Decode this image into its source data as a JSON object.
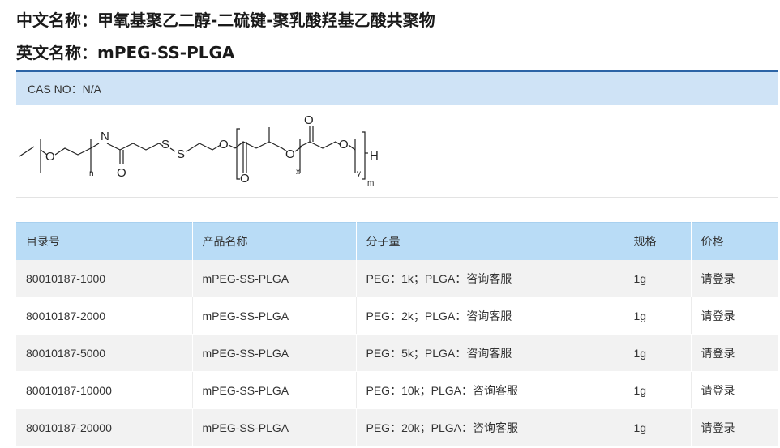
{
  "product": {
    "cn_label": "中文名称：",
    "cn_name": "甲氧基聚乙二醇-二硫键-聚乳酸羟基乙酸共聚物",
    "en_label": "英文名称：",
    "en_name": "mPEG-SS-PLGA",
    "cas": "CAS NO：N/A"
  },
  "structure": {
    "atoms": {
      "o": "O",
      "n": "N",
      "h": "H",
      "s": "S"
    },
    "subscripts": {
      "n": "n",
      "x": "x",
      "y": "y",
      "m": "m"
    }
  },
  "table": {
    "headers": [
      "目录号",
      "产品名称",
      "分子量",
      "规格",
      "价格"
    ],
    "rows": [
      [
        "80010187-1000",
        "mPEG-SS-PLGA",
        "PEG：1k；PLGA：咨询客服",
        "1g",
        "请登录"
      ],
      [
        "80010187-2000",
        "mPEG-SS-PLGA",
        "PEG：2k；PLGA：咨询客服",
        "1g",
        "请登录"
      ],
      [
        "80010187-5000",
        "mPEG-SS-PLGA",
        "PEG：5k；PLGA：咨询客服",
        "1g",
        "请登录"
      ],
      [
        "80010187-10000",
        "mPEG-SS-PLGA",
        "PEG：10k；PLGA：咨询客服",
        "1g",
        "请登录"
      ],
      [
        "80010187-20000",
        "mPEG-SS-PLGA",
        "PEG：20k；PLGA：咨询客服",
        "1g",
        "请登录"
      ]
    ]
  },
  "colors": {
    "header_bg": "#b9dcf6",
    "cas_bg": "#cfe3f6",
    "accent_line": "#2c64a6"
  }
}
